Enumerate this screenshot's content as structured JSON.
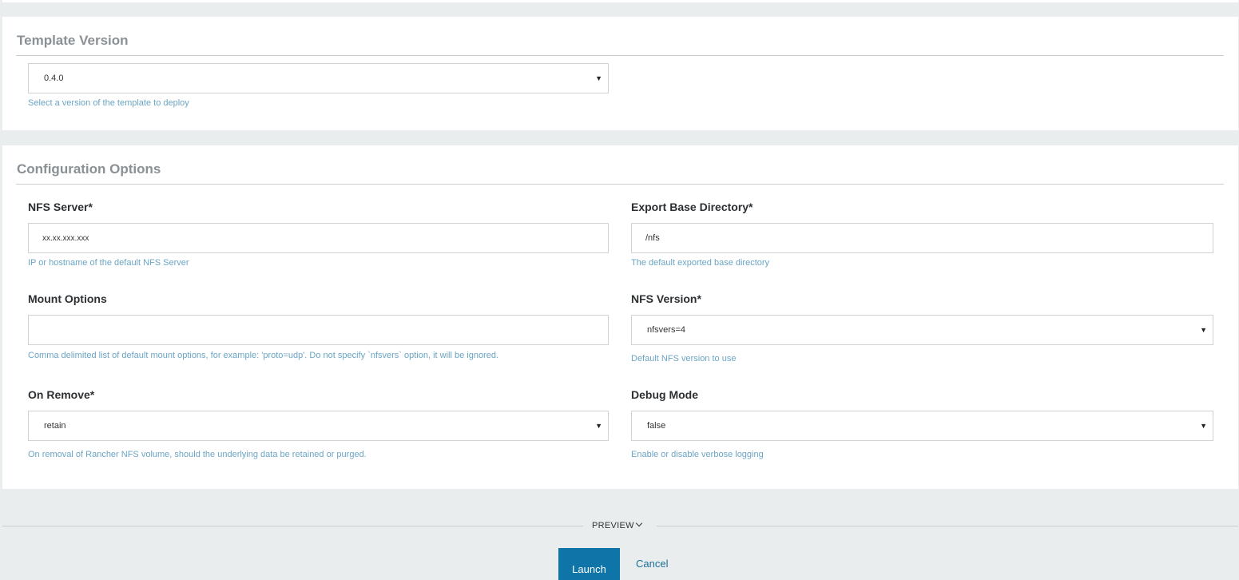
{
  "template_section": {
    "title": "Template Version",
    "version_select": {
      "value": "0.4.0"
    },
    "help": "Select a version of the template to deploy"
  },
  "config_section": {
    "title": "Configuration Options",
    "nfs_server": {
      "label": "NFS Server*",
      "value": "xx.xx.xxx.xxx",
      "help": "IP or hostname of the default NFS Server"
    },
    "export_base_dir": {
      "label": "Export Base Directory*",
      "value": "/nfs",
      "help": "The default exported base directory"
    },
    "mount_options": {
      "label": "Mount Options",
      "value": "",
      "help": "Comma delimited list of default mount options, for example: 'proto=udp'. Do not specify `nfsvers` option, it will be ignored."
    },
    "nfs_version": {
      "label": "NFS Version*",
      "value": "nfsvers=4",
      "help": "Default NFS version to use"
    },
    "on_remove": {
      "label": "On Remove*",
      "value": "retain",
      "help": "On removal of Rancher NFS volume, should the underlying data be retained or purged."
    },
    "debug_mode": {
      "label": "Debug Mode",
      "value": "false",
      "help": "Enable or disable verbose logging"
    }
  },
  "footer": {
    "preview_label": "PREVIEW",
    "launch_label": "Launch",
    "cancel_label": "Cancel"
  },
  "icons": {
    "dropdown_caret": "caret-down-icon",
    "preview_chevron": "chevron-down-icon"
  },
  "colors": {
    "page_background": "#e9edee",
    "help_text": "#6ba5c4",
    "launch_button": "#0f75a8",
    "cancel_link": "#1b6d9a"
  }
}
